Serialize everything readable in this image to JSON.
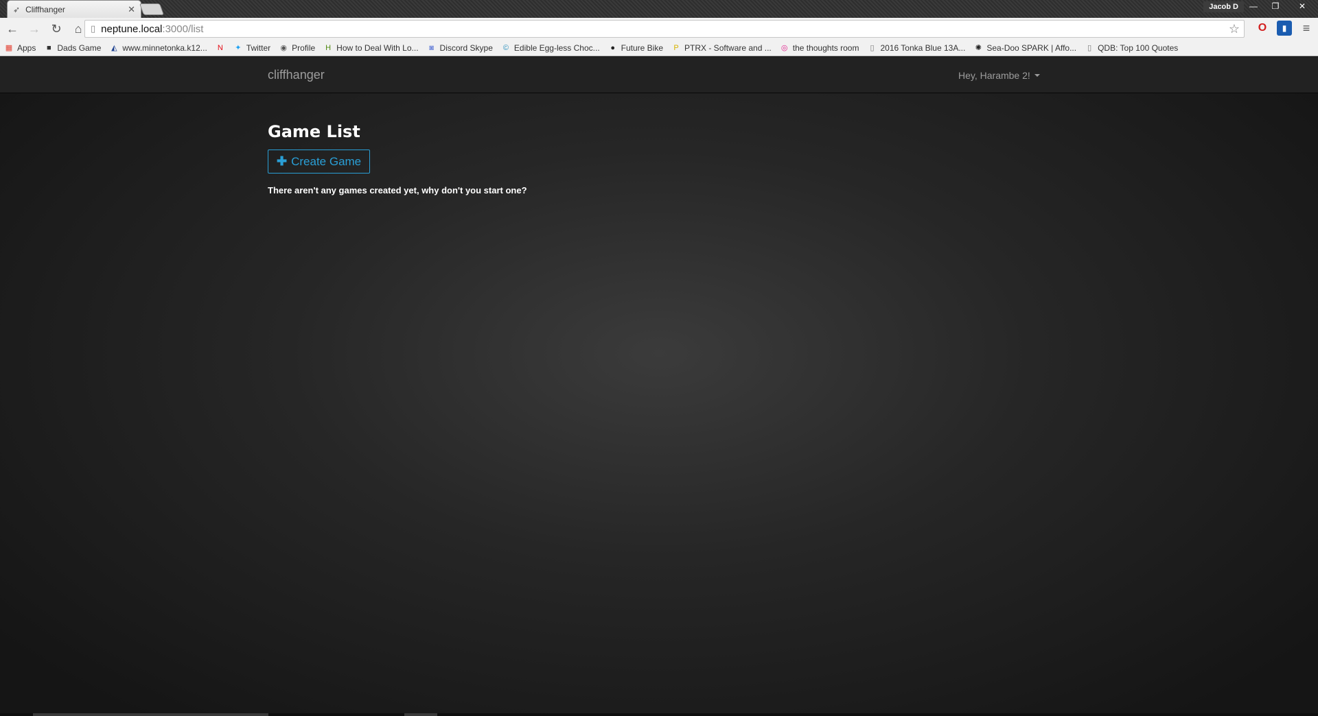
{
  "browser": {
    "tab": {
      "title": "Cliffhanger",
      "favicon": "rocket-icon"
    },
    "profile": "Jacob D",
    "window_controls": {
      "minimize": "—",
      "restore": "❐",
      "close": "✕"
    },
    "nav": {
      "back": "←",
      "forward": "→",
      "reload": "↻",
      "home": "⌂"
    },
    "url": {
      "host": "neptune.local",
      "path": ":3000/list"
    },
    "bookmarks": [
      {
        "label": "Apps",
        "icon": "apps-grid-icon",
        "glyph": "▦",
        "color": "#e34133"
      },
      {
        "label": "Dads Game",
        "icon": "dads-game-icon",
        "glyph": "■",
        "color": "#333333"
      },
      {
        "label": "www.minnetonka.k12...",
        "icon": "minnetonka-icon",
        "glyph": "◭",
        "color": "#1b3f8f"
      },
      {
        "label": "",
        "icon": "netflix-icon",
        "glyph": "N",
        "color": "#e50914"
      },
      {
        "label": "Twitter",
        "icon": "twitter-icon",
        "glyph": "✦",
        "color": "#1da1f2"
      },
      {
        "label": "Profile",
        "icon": "profile-icon",
        "glyph": "◉",
        "color": "#555555"
      },
      {
        "label": "How to Deal With Lo...",
        "icon": "wikihow-icon",
        "glyph": "H",
        "color": "#4f8a10"
      },
      {
        "label": "Discord Skype",
        "icon": "discord-icon",
        "glyph": "◙",
        "color": "#7289da"
      },
      {
        "label": "Edible Egg-less Choc...",
        "icon": "recipe-icon",
        "glyph": "©",
        "color": "#2a8fbd"
      },
      {
        "label": "Future Bike",
        "icon": "bike-icon",
        "glyph": "●",
        "color": "#222222"
      },
      {
        "label": "PTRX - Software and ...",
        "icon": "ptrx-icon",
        "glyph": "P",
        "color": "#d6b400"
      },
      {
        "label": "the thoughts room",
        "icon": "thoughts-room-icon",
        "glyph": "◎",
        "color": "#e0208c"
      },
      {
        "label": "2016 Tonka Blue 13A...",
        "icon": "page-icon",
        "glyph": "▯",
        "color": "#777777"
      },
      {
        "label": "Sea-Doo SPARK | Affo...",
        "icon": "seadoo-icon",
        "glyph": "✺",
        "color": "#222222"
      },
      {
        "label": "QDB: Top 100 Quotes",
        "icon": "page-icon",
        "glyph": "▯",
        "color": "#777777"
      }
    ]
  },
  "app": {
    "brand": "cliffhanger",
    "user_greeting": "Hey, Harambe 2!",
    "page_title": "Game List",
    "create_button": "Create Game",
    "empty_message": "There aren't any games created yet, why don't you start one?",
    "accent_color": "#2a9fd6"
  }
}
